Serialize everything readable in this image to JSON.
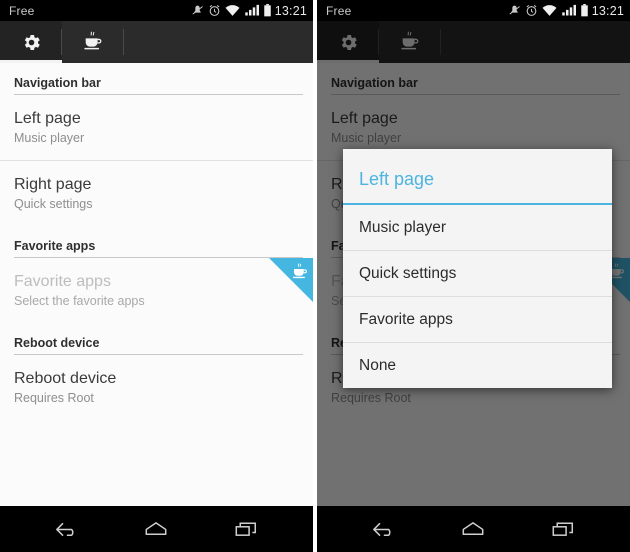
{
  "status_bar": {
    "carrier": "Free",
    "clock": "13:21",
    "icons": [
      "vibrate-off-icon",
      "alarm-icon",
      "wifi-icon",
      "signal-icon",
      "battery-icon"
    ]
  },
  "tab_bar": {
    "tabs": [
      {
        "name": "settings-tab",
        "icon": "gear-icon",
        "active": true
      },
      {
        "name": "donate-tab",
        "icon": "coffee-cup-icon",
        "active": false
      }
    ]
  },
  "colors": {
    "accent": "#33b5e5",
    "badge": "#45b6e0",
    "action_bar": "#2b2b2b",
    "content_bg": "#fbfbfb",
    "dialog_bg": "#f4f4f4"
  },
  "preferences": {
    "sections": [
      {
        "header": "Navigation bar",
        "items": [
          {
            "title": "Left page",
            "summary": "Music player",
            "disabled": false,
            "pro": false
          },
          {
            "title": "Right page",
            "summary": "Quick settings",
            "disabled": false,
            "pro": false
          }
        ]
      },
      {
        "header": "Favorite apps",
        "items": [
          {
            "title": "Favorite apps",
            "summary": "Select the favorite apps",
            "disabled": true,
            "pro": true
          }
        ]
      },
      {
        "header": "Reboot device",
        "items": [
          {
            "title": "Reboot device",
            "summary": "Requires Root",
            "disabled": false,
            "pro": false
          }
        ]
      }
    ]
  },
  "dialog": {
    "title": "Left page",
    "options": [
      "Music player",
      "Quick settings",
      "Favorite apps",
      "None"
    ]
  },
  "nav_bar": {
    "buttons": [
      {
        "name": "back-button",
        "icon": "back-arrow-icon"
      },
      {
        "name": "home-button",
        "icon": "home-icon"
      },
      {
        "name": "recents-button",
        "icon": "recents-icon"
      }
    ]
  }
}
